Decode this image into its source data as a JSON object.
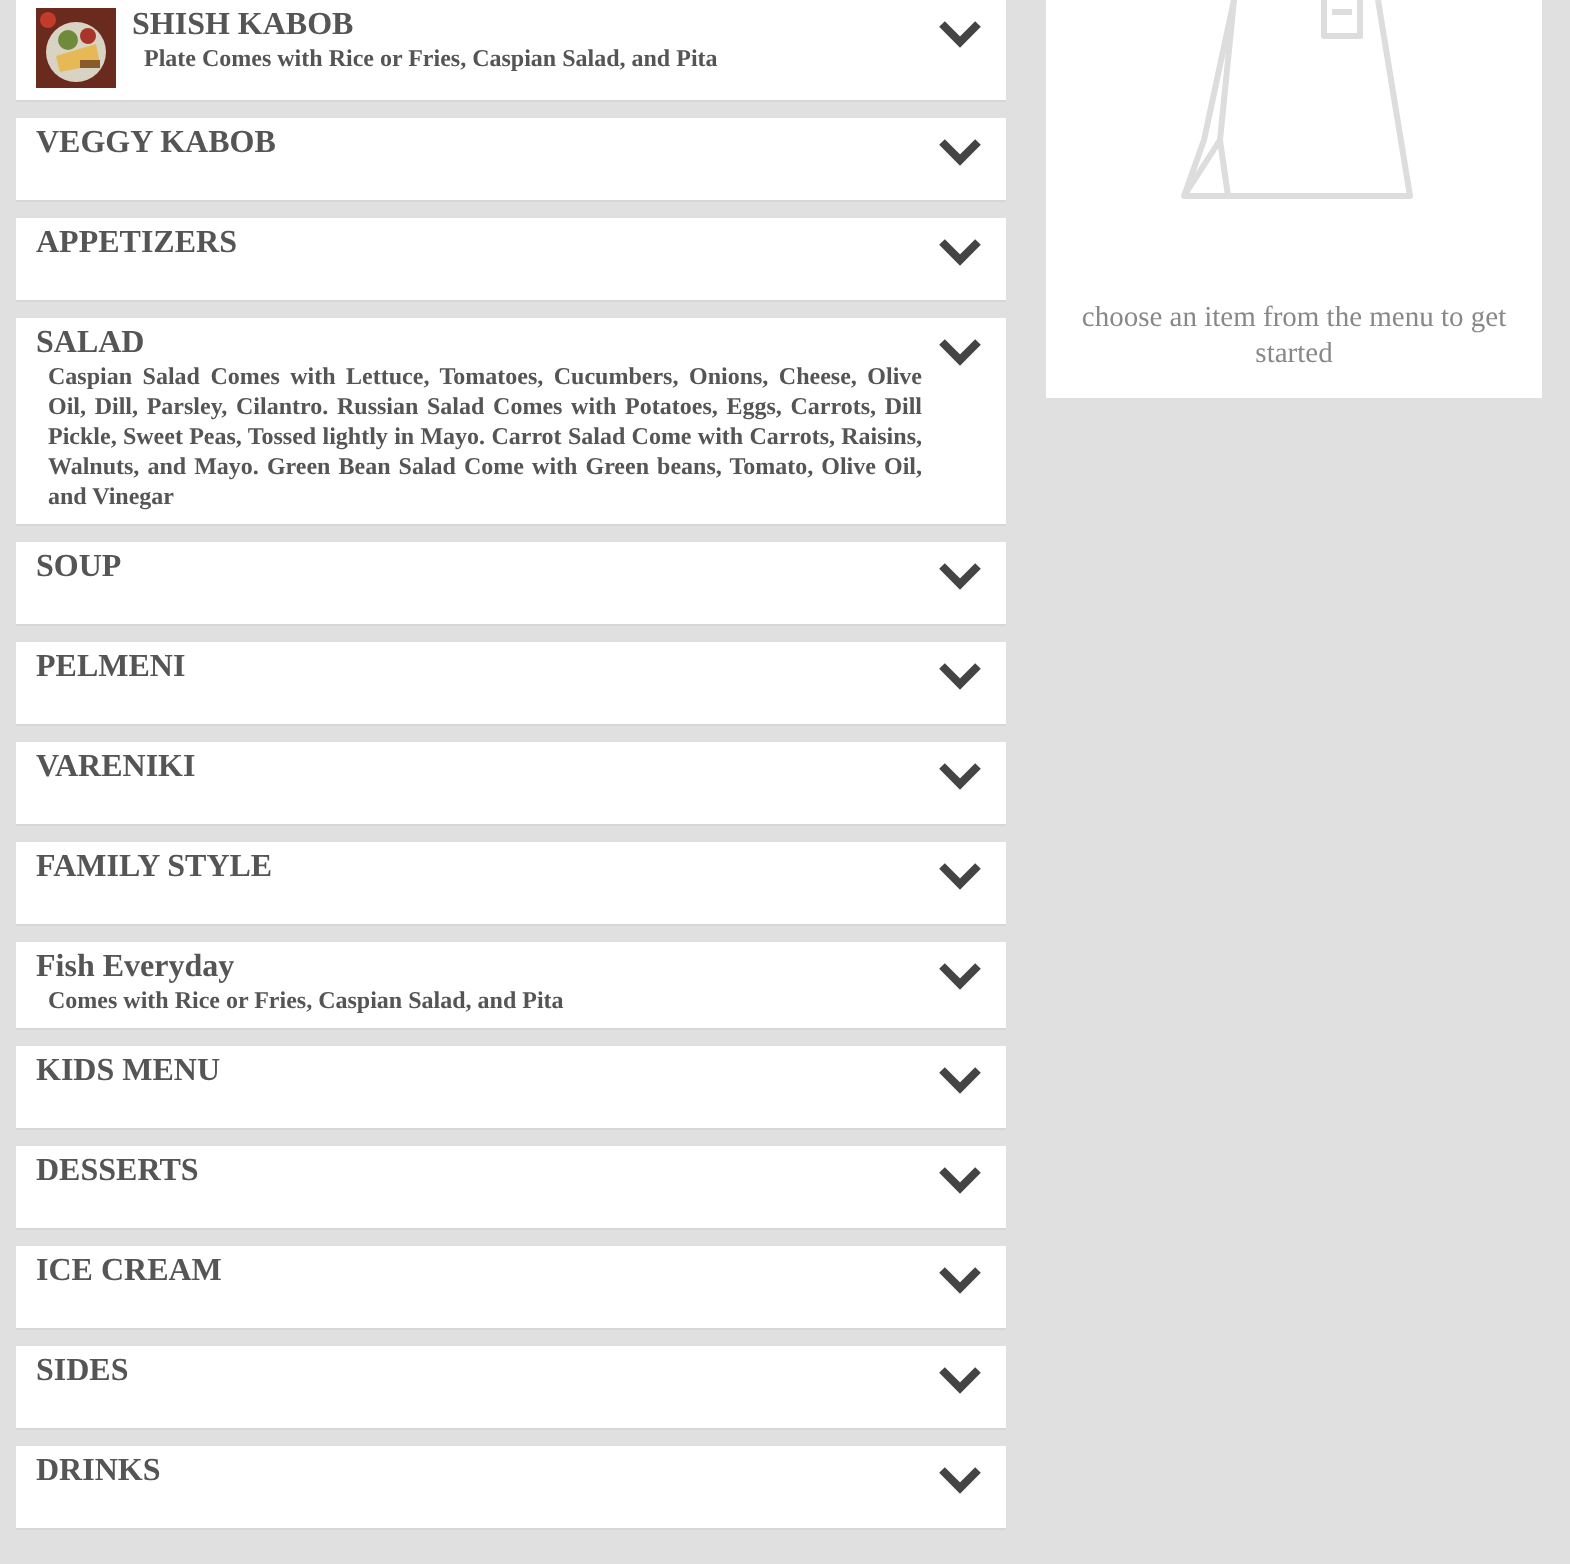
{
  "menu_categories": [
    {
      "title": "SHISH KABOB",
      "description": "Plate Comes with Rice or Fries, Caspian Salad, and Pita"
    },
    {
      "title": "VEGGY KABOB"
    },
    {
      "title": "APPETIZERS"
    },
    {
      "title": "SALAD",
      "description": "Caspian Salad Comes with Lettuce, Tomatoes, Cucumbers, Onions, Cheese, Olive Oil, Dill, Parsley, Cilantro. Russian Salad Comes with Potatoes, Eggs, Carrots, Dill Pickle, Sweet Peas, Tossed lightly in Mayo. Carrot Salad Come with Carrots, Raisins, Walnuts, and Mayo. Green Bean Salad Come with Green beans, Tomato, Olive Oil, and Vinegar"
    },
    {
      "title": "SOUP"
    },
    {
      "title": "PELMENI"
    },
    {
      "title": "VARENIKI"
    },
    {
      "title": "FAMILY STYLE"
    },
    {
      "title": "Fish Everyday",
      "description": "Comes with Rice or Fries, Caspian Salad, and Pita"
    },
    {
      "title": "KIDS MENU"
    },
    {
      "title": "DESSERTS"
    },
    {
      "title": "ICE CREAM"
    },
    {
      "title": "SIDES"
    },
    {
      "title": "DRINKS"
    }
  ],
  "cart": {
    "empty_message": "choose an item from the menu to get started"
  }
}
